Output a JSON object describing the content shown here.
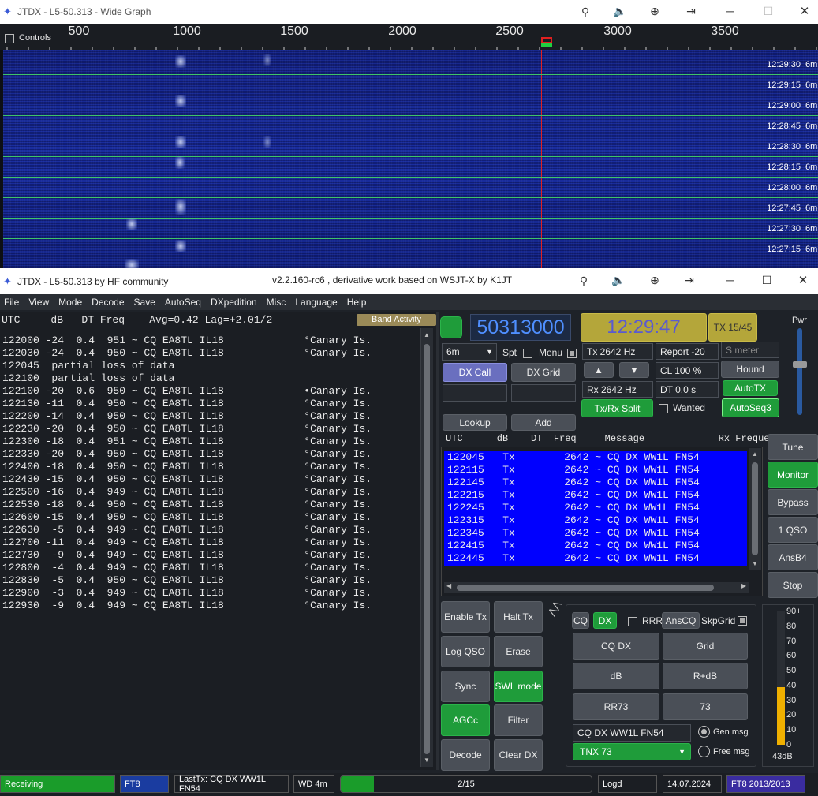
{
  "wide_graph": {
    "title": "JTDX - L5-50.313 - Wide Graph",
    "controls_label": "Controls",
    "ruler_ticks": [
      "500",
      "1000",
      "1500",
      "2000",
      "2500",
      "3000",
      "3500"
    ],
    "rows": [
      {
        "time": "12:29:30",
        "band": "6m"
      },
      {
        "time": "12:29:15",
        "band": "6m"
      },
      {
        "time": "12:29:00",
        "band": "6m"
      },
      {
        "time": "12:28:45",
        "band": "6m"
      },
      {
        "time": "12:28:30",
        "band": "6m"
      },
      {
        "time": "12:28:15",
        "band": "6m"
      },
      {
        "time": "12:28:00",
        "band": "6m"
      },
      {
        "time": "12:27:45",
        "band": "6m"
      },
      {
        "time": "12:27:30",
        "band": "6m"
      },
      {
        "time": "12:27:15",
        "band": "6m"
      }
    ]
  },
  "main": {
    "title_left": "JTDX - L5-50.313  by HF community",
    "title_center": "v2.2.160-rc6 , derivative work based on WSJT-X by K1JT",
    "menu": [
      "File",
      "View",
      "Mode",
      "Decode",
      "Save",
      "AutoSeq",
      "DXpedition",
      "Misc",
      "Language",
      "Help"
    ]
  },
  "left": {
    "header": "UTC     dB   DT Freq    Avg=0.42 Lag=+2.01/2",
    "band_activity": "Band Activity",
    "lines": [
      "122000 -24  0.4  951 ~ CQ EA8TL IL18             °Canary Is.",
      "122030 -24  0.4  950 ~ CQ EA8TL IL18             °Canary Is.",
      "122045  partial loss of data",
      "122100  partial loss of data",
      "122100 -20  0.6  950 ~ CQ EA8TL IL18             •Canary Is.",
      "122130 -11  0.4  950 ~ CQ EA8TL IL18             °Canary Is.",
      "122200 -14  0.4  950 ~ CQ EA8TL IL18             °Canary Is.",
      "122230 -20  0.4  950 ~ CQ EA8TL IL18             °Canary Is.",
      "122300 -18  0.4  951 ~ CQ EA8TL IL18             °Canary Is.",
      "122330 -20  0.4  950 ~ CQ EA8TL IL18             °Canary Is.",
      "122400 -18  0.4  950 ~ CQ EA8TL IL18             °Canary Is.",
      "122430 -15  0.4  950 ~ CQ EA8TL IL18             °Canary Is.",
      "122500 -16  0.4  949 ~ CQ EA8TL IL18             °Canary Is.",
      "122530 -18  0.4  950 ~ CQ EA8TL IL18             °Canary Is.",
      "122600 -15  0.4  950 ~ CQ EA8TL IL18             °Canary Is.",
      "122630  -5  0.4  949 ~ CQ EA8TL IL18             °Canary Is.",
      "122700 -11  0.4  949 ~ CQ EA8TL IL18             °Canary Is.",
      "122730  -9  0.4  949 ~ CQ EA8TL IL18             °Canary Is.",
      "122800  -4  0.4  949 ~ CQ EA8TL IL18             °Canary Is.",
      "122830  -5  0.4  950 ~ CQ EA8TL IL18             °Canary Is.",
      "122900  -3  0.4  949 ~ CQ EA8TL IL18             °Canary Is.",
      "122930  -9  0.4  949 ~ CQ EA8TL IL18             °Canary Is."
    ]
  },
  "right": {
    "frequency": "50313000",
    "clock": "12:29:47",
    "tx_period": "TX 15/45",
    "pwr": "Pwr",
    "band": "6m",
    "spt": "Spt",
    "menu": "Menu",
    "dx_call": "DX Call",
    "dx_grid": "DX Grid",
    "tx_freq": "Tx  2642  Hz",
    "rx_freq": "Rx  2642  Hz",
    "report": "Report -20",
    "smeter": "S meter",
    "cl": "CL  100  %",
    "dt": "DT  0.0  s",
    "hound": "Hound",
    "autotx": "AutoTX",
    "txrx_split": "Tx/Rx Split",
    "wanted": "Wanted",
    "autoseq3": "AutoSeq3",
    "lookup": "Lookup",
    "add": "Add",
    "tx_header": "UTC      dB    DT  Freq     Message             Rx Frequency",
    "tx_lines": [
      "122045   Tx        2642 ~ CQ DX WW1L FN54",
      "122115   Tx        2642 ~ CQ DX WW1L FN54",
      "122145   Tx        2642 ~ CQ DX WW1L FN54",
      "122215   Tx        2642 ~ CQ DX WW1L FN54",
      "122245   Tx        2642 ~ CQ DX WW1L FN54",
      "122315   Tx        2642 ~ CQ DX WW1L FN54",
      "122345   Tx        2642 ~ CQ DX WW1L FN54",
      "122415   Tx        2642 ~ CQ DX WW1L FN54",
      "122445   Tx        2642 ~ CQ DX WW1L FN54"
    ],
    "side_buttons": [
      "Tune",
      "Monitor",
      "Bypass",
      "1 QSO",
      "AnsB4",
      "Stop"
    ],
    "ctrl_buttons": [
      "Enable Tx",
      "Halt Tx",
      "Log QSO",
      "Erase",
      "Sync",
      "SWL mode",
      "AGCc",
      "Filter",
      "Decode",
      "Clear DX"
    ],
    "cq": "CQ",
    "dx": "DX",
    "rrr": "RRR",
    "anscq": "AnsCQ",
    "skpgrid": "SkpGrid",
    "msg_buttons": [
      "CQ DX",
      "Grid",
      "dB",
      "R+dB",
      "RR73",
      "73"
    ],
    "gen_msg_text": "CQ DX WW1L FN54",
    "gen_msg": "Gen msg",
    "free_msg_text": "TNX 73",
    "free_msg": "Free msg",
    "meter_ticks": [
      "90+",
      "80",
      "70",
      "60",
      "50",
      "40",
      "30",
      "20",
      "10",
      "0"
    ],
    "meter_db": "43dB",
    "meter_level": 0.43
  },
  "status": {
    "receiving": "Receiving",
    "mode": "FT8",
    "last_tx": "LastTx: CQ DX WW1L FN54",
    "wd": "WD 4m",
    "progress_text": "2/15",
    "progress": 0.133,
    "logd": "Logd",
    "date": "14.07.2024",
    "mode_period": "FT8  2013/2013"
  },
  "colors": {
    "accent_green": "#1f9c3a",
    "tx_list_bg": "#0000ff",
    "clock_gold": "#b4a63a",
    "freq_text": "#4f8fff"
  }
}
